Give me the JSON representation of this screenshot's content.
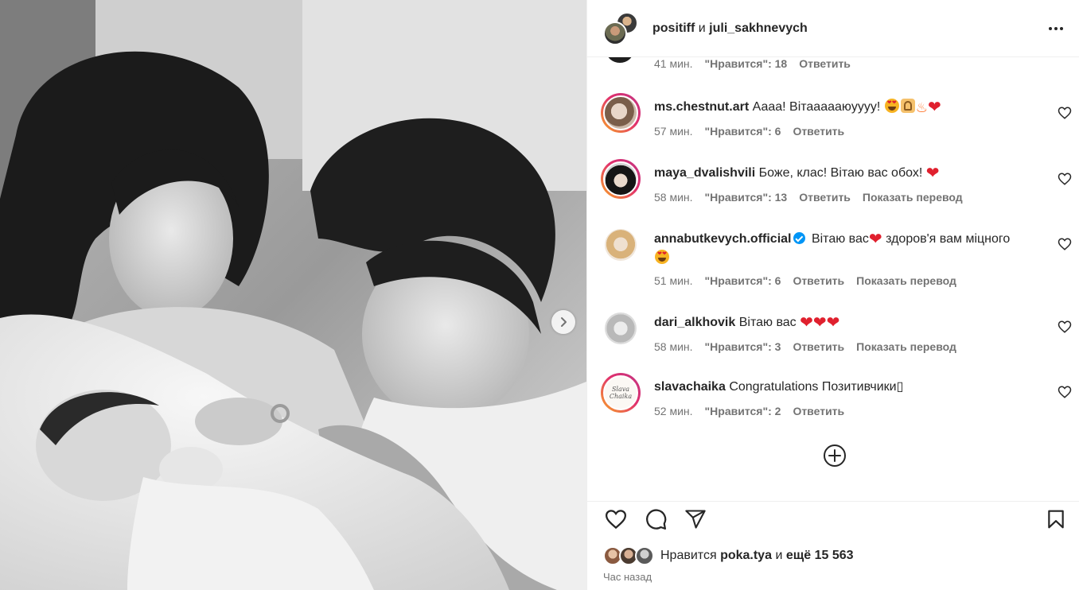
{
  "post": {
    "header": {
      "user1": "positiff",
      "conj": "и",
      "user2": "juli_sakhnevych"
    },
    "photo_icons": {
      "next": "chevron-right-icon"
    },
    "partial_comment": {
      "time": "41 мин.",
      "likes": "\"Нравится\": 18",
      "reply": "Ответить"
    },
    "comments": [
      {
        "user": "ms.chestnut.art",
        "text": "Аааа! Вітаааааюуууу!",
        "time": "57 мин.",
        "likes": "\"Нравится\": 6",
        "reply": "Ответить",
        "translate": ""
      },
      {
        "user": "maya_dvalishvili",
        "text": "Боже, клас! Вітаю вас обох!",
        "time": "58 мин.",
        "likes": "\"Нравится\": 13",
        "reply": "Ответить",
        "translate": "Показать перевод"
      },
      {
        "user": "annabutkevych.official",
        "text": "Вітаю вас",
        "text2": " здоров'я вам міцного",
        "time": "51 мин.",
        "likes": "\"Нравится\": 6",
        "reply": "Ответить",
        "translate": "Показать перевод"
      },
      {
        "user": "dari_alkhovik",
        "text": "Вітаю вас",
        "time": "58 мин.",
        "likes": "\"Нравится\": 3",
        "reply": "Ответить",
        "translate": "Показать перевод"
      },
      {
        "user": "slavachaika",
        "text": "Congratulations Позитивчики",
        "text_tail": "▯",
        "time": "52 мин.",
        "likes": "\"Нравится\": 2",
        "reply": "Ответить",
        "translate": ""
      }
    ],
    "footer": {
      "likes_prefix": "Нравится",
      "likes_user": "poka.tya",
      "likes_and": "и",
      "likes_rest": "ещё 15 563",
      "time_ago": "Час назад"
    },
    "icons": {
      "more": "more-horizontal-icon",
      "like": "heart-icon",
      "comment": "comment-icon",
      "share": "share-icon",
      "save": "bookmark-icon",
      "load_more": "plus-circle-icon"
    },
    "colors": {
      "text": "#262626",
      "secondary": "#737373",
      "heart_emoji": "#e0202e",
      "verified": "#0095f6"
    }
  }
}
